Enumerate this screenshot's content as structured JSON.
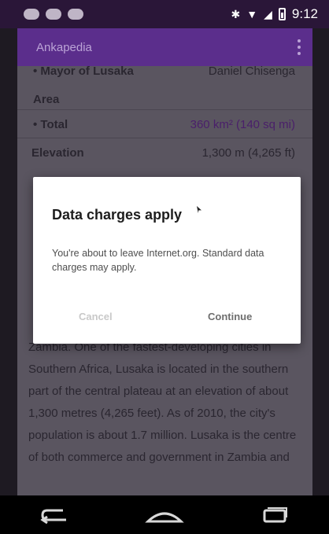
{
  "status_bar": {
    "time": "9:12"
  },
  "app_bar": {
    "title": "Ankapedia"
  },
  "infobox": {
    "mayor_label": "• Mayor of Lusaka",
    "mayor_value": "Daniel Chisenga",
    "area_label": "Area",
    "total_label": "• Total",
    "total_value": "360 km² (140 sq mi)",
    "elevation_label": "Elevation",
    "elevation_value": "1,300 m (4,265 ft)"
  },
  "article": {
    "paragraph": "Zambia. One of the fastest-developing cities in Southern Africa, Lusaka is located in the southern part of the central plateau at an elevation of about 1,300 metres (4,265 feet). As of 2010, the city's population is about 1.7 million. Lusaka is the centre of both commerce and government in Zambia and"
  },
  "dialog": {
    "title": "Data charges apply",
    "message": "You're about to leave Internet.org. Standard data charges may apply.",
    "cancel_label": "Cancel",
    "continue_label": "Continue"
  },
  "colors": {
    "accent": "#5b2e8c",
    "status_bar": "#2a1638",
    "dim_overlay": "#5a5560"
  },
  "icons": [
    "back-icon",
    "home-icon",
    "recents-icon",
    "wifi-icon",
    "signal-icon",
    "battery-icon",
    "overflow-menu-icon"
  ]
}
